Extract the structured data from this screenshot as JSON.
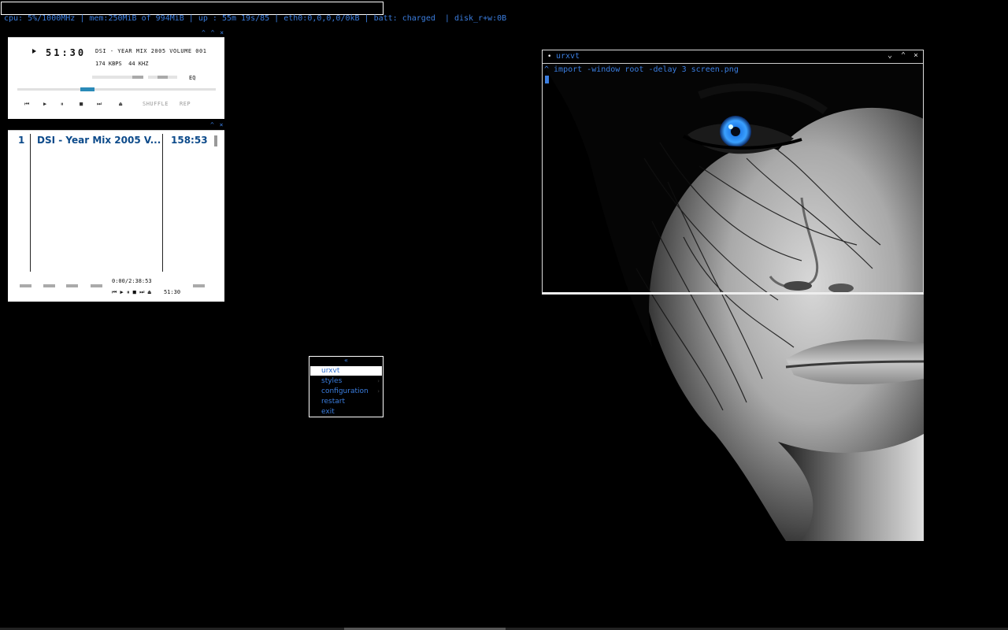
{
  "status_bar": {
    "text": "cpu: 5%/1000MHz | mem:250MiB of 994MiB | up : 55m 19s/85 | eth0:0,0,0,0/0kB | batt: charged  | disk_r+w:0B"
  },
  "player": {
    "controls": "^ ^ ×",
    "time": "51:30",
    "marquee": "DSI - YEAR MIX 2005 VOLUME 001",
    "rate": "174 KBPS  44 KHZ",
    "eq": "EQ",
    "shuffle": "SHUFFLE",
    "repeat": "REP",
    "seek_position": 0.34,
    "volume": 0.8,
    "buttons": {
      "prev": "⏮",
      "play": "▶",
      "pause": "⏸",
      "stop": "■",
      "next": "⏭",
      "eject": "⏏"
    }
  },
  "playlist": {
    "controls": "^ ×",
    "number": "1",
    "title": "DSI - Year Mix 2005 V...",
    "length": "158:53",
    "time_display": "0:00/2:38:53",
    "mini_controls": "⏮ ▶ ⏸ ■ ⏭ ⏏",
    "elapsed": "51:30"
  },
  "terminal": {
    "title": "urxvt",
    "command": "^ import -window root -delay 3 screen.png",
    "buttons": {
      "shade": "⌄",
      "maximize": "⌃",
      "close": "×"
    }
  },
  "root_menu": {
    "title": "«",
    "items": [
      {
        "label": "urxvt",
        "selected": true,
        "submenu": false
      },
      {
        "label": "styles",
        "selected": false,
        "submenu": true
      },
      {
        "label": "configuration",
        "selected": false,
        "submenu": true
      },
      {
        "label": "restart",
        "selected": false,
        "submenu": false
      },
      {
        "label": "exit",
        "selected": false,
        "submenu": false
      }
    ],
    "submenu_arrow": "›"
  },
  "colors": {
    "accent": "#3b7ee0",
    "background": "#000000",
    "playlist_text": "#0c4a8a",
    "seek_fill": "#2a8ab8"
  },
  "icons": [
    "play-icon",
    "prev-icon",
    "pause-icon",
    "stop-icon",
    "next-icon",
    "eject-icon",
    "close-icon",
    "maximize-icon",
    "shade-icon"
  ]
}
